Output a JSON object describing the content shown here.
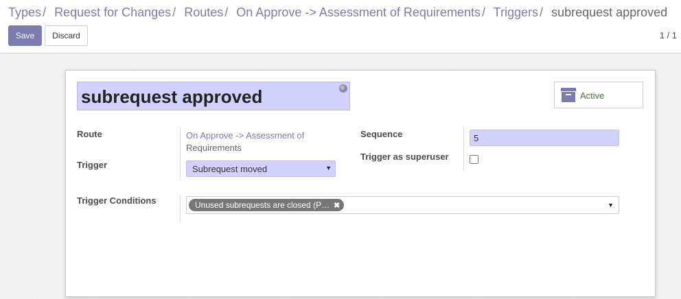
{
  "breadcrumb": {
    "items": [
      "Types",
      "Request for Changes",
      "Routes",
      "On Approve -> Assessment of Requirements",
      "Triggers"
    ],
    "current": "subrequest approved",
    "separator": "/"
  },
  "toolbar": {
    "save_label": "Save",
    "discard_label": "Discard",
    "pager": "1 / 1"
  },
  "form": {
    "name": "subrequest approved",
    "active_button": {
      "label": "Active",
      "icon": "archive-icon"
    },
    "fields": {
      "route": {
        "label": "Route",
        "value_line1": "On Approve -> Assessment of",
        "value_line2": "Requirements"
      },
      "trigger": {
        "label": "Trigger",
        "value": "Subrequest moved"
      },
      "sequence": {
        "label": "Sequence",
        "value": "5"
      },
      "trigger_as_superuser": {
        "label": "Trigger as superuser",
        "checked": false
      },
      "trigger_conditions": {
        "label": "Trigger Conditions",
        "tags": [
          "Unused subrequests are closed (P…"
        ]
      }
    }
  },
  "colors": {
    "accent": "#7c7bad",
    "input_bg": "#d2d2ff",
    "active_text": "#3c7a3c"
  }
}
